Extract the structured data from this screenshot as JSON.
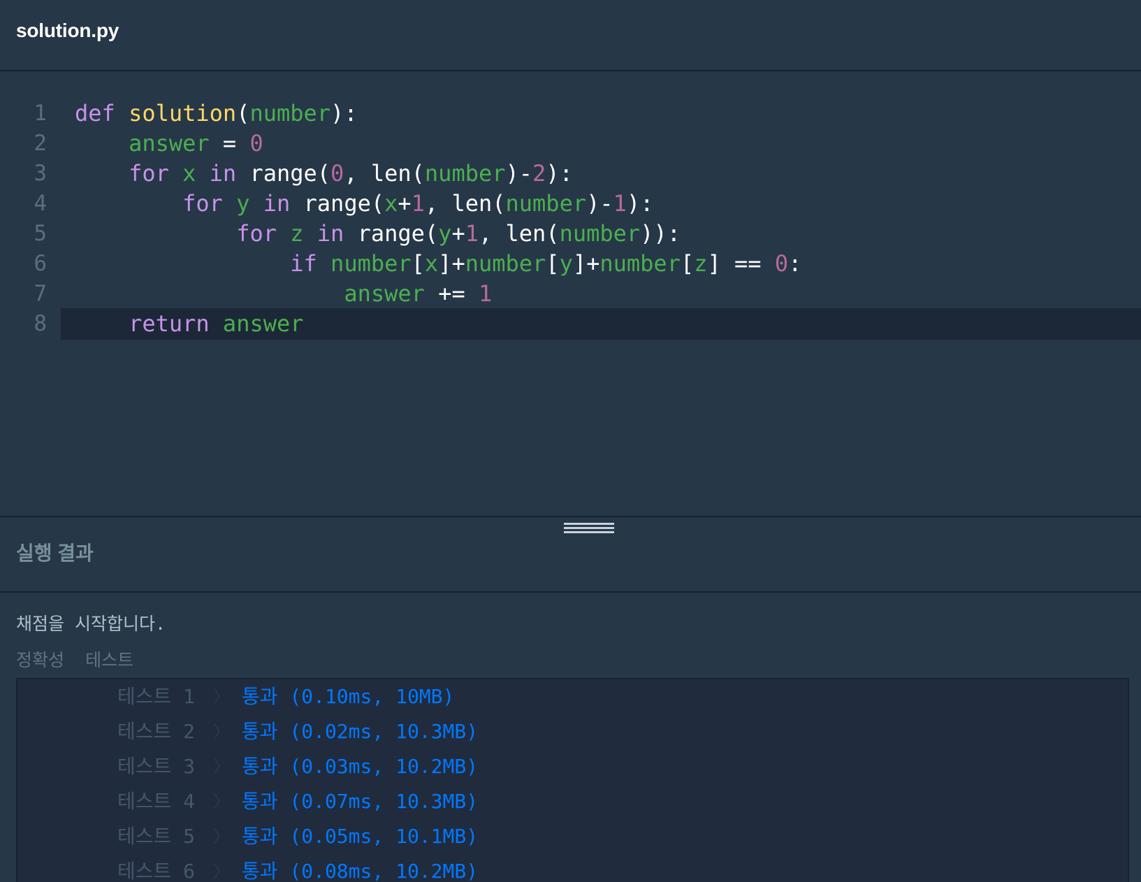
{
  "header": {
    "file_name": "solution.py"
  },
  "colors": {
    "keyword": "#c792ea",
    "function": "#ffd866",
    "variable": "#4caf50",
    "number": "#b76a9d",
    "plain": "#ffffff",
    "line_number": "#5d6d7e",
    "pass": "#0078ff"
  },
  "editor": {
    "line_numbers": [
      "1",
      "2",
      "3",
      "4",
      "5",
      "6",
      "7",
      "8"
    ],
    "active_line": 8,
    "lines": [
      [
        [
          "def",
          "keyword"
        ],
        [
          " ",
          "plain"
        ],
        [
          "solution",
          "function"
        ],
        [
          "(",
          "plain"
        ],
        [
          "number",
          "variable"
        ],
        [
          "):",
          "plain"
        ]
      ],
      [
        [
          "    ",
          "plain"
        ],
        [
          "answer",
          "variable"
        ],
        [
          " = ",
          "plain"
        ],
        [
          "0",
          "number"
        ]
      ],
      [
        [
          "    ",
          "plain"
        ],
        [
          "for",
          "keyword"
        ],
        [
          " ",
          "plain"
        ],
        [
          "x",
          "variable"
        ],
        [
          " ",
          "plain"
        ],
        [
          "in",
          "keyword"
        ],
        [
          " range(",
          "plain"
        ],
        [
          "0",
          "number"
        ],
        [
          ", len(",
          "plain"
        ],
        [
          "number",
          "variable"
        ],
        [
          ")-",
          "plain"
        ],
        [
          "2",
          "number"
        ],
        [
          "):",
          "plain"
        ]
      ],
      [
        [
          "        ",
          "plain"
        ],
        [
          "for",
          "keyword"
        ],
        [
          " ",
          "plain"
        ],
        [
          "y",
          "variable"
        ],
        [
          " ",
          "plain"
        ],
        [
          "in",
          "keyword"
        ],
        [
          " range(",
          "plain"
        ],
        [
          "x",
          "variable"
        ],
        [
          "+",
          "plain"
        ],
        [
          "1",
          "number"
        ],
        [
          ", len(",
          "plain"
        ],
        [
          "number",
          "variable"
        ],
        [
          ")-",
          "plain"
        ],
        [
          "1",
          "number"
        ],
        [
          "):",
          "plain"
        ]
      ],
      [
        [
          "            ",
          "plain"
        ],
        [
          "for",
          "keyword"
        ],
        [
          " ",
          "plain"
        ],
        [
          "z",
          "variable"
        ],
        [
          " ",
          "plain"
        ],
        [
          "in",
          "keyword"
        ],
        [
          " range(",
          "plain"
        ],
        [
          "y",
          "variable"
        ],
        [
          "+",
          "plain"
        ],
        [
          "1",
          "number"
        ],
        [
          ", len(",
          "plain"
        ],
        [
          "number",
          "variable"
        ],
        [
          "))",
          "plain"
        ],
        [
          ":",
          "plain"
        ]
      ],
      [
        [
          "                ",
          "plain"
        ],
        [
          "if",
          "keyword"
        ],
        [
          " ",
          "plain"
        ],
        [
          "number",
          "variable"
        ],
        [
          "[",
          "plain"
        ],
        [
          "x",
          "variable"
        ],
        [
          "]+",
          "plain"
        ],
        [
          "number",
          "variable"
        ],
        [
          "[",
          "plain"
        ],
        [
          "y",
          "variable"
        ],
        [
          "]+",
          "plain"
        ],
        [
          "number",
          "variable"
        ],
        [
          "[",
          "plain"
        ],
        [
          "z",
          "variable"
        ],
        [
          "] == ",
          "plain"
        ],
        [
          "0",
          "number"
        ],
        [
          ":",
          "plain"
        ]
      ],
      [
        [
          "                    ",
          "plain"
        ],
        [
          "answer",
          "variable"
        ],
        [
          " += ",
          "plain"
        ],
        [
          "1",
          "number"
        ]
      ],
      [
        [
          "    ",
          "plain"
        ],
        [
          "return",
          "keyword"
        ],
        [
          " ",
          "plain"
        ],
        [
          "answer",
          "variable"
        ]
      ]
    ]
  },
  "result": {
    "title": "실행 결과",
    "message": "채점을 시작합니다.",
    "section_label": "정확성  테스트",
    "arrow_glyph": "〉",
    "tests": [
      {
        "name": "테스트 1",
        "result": "통과 (0.10ms, 10MB)"
      },
      {
        "name": "테스트 2",
        "result": "통과 (0.02ms, 10.3MB)"
      },
      {
        "name": "테스트 3",
        "result": "통과 (0.03ms, 10.2MB)"
      },
      {
        "name": "테스트 4",
        "result": "통과 (0.07ms, 10.3MB)"
      },
      {
        "name": "테스트 5",
        "result": "통과 (0.05ms, 10.1MB)"
      },
      {
        "name": "테스트 6",
        "result": "통과 (0.08ms, 10.2MB)"
      }
    ]
  }
}
